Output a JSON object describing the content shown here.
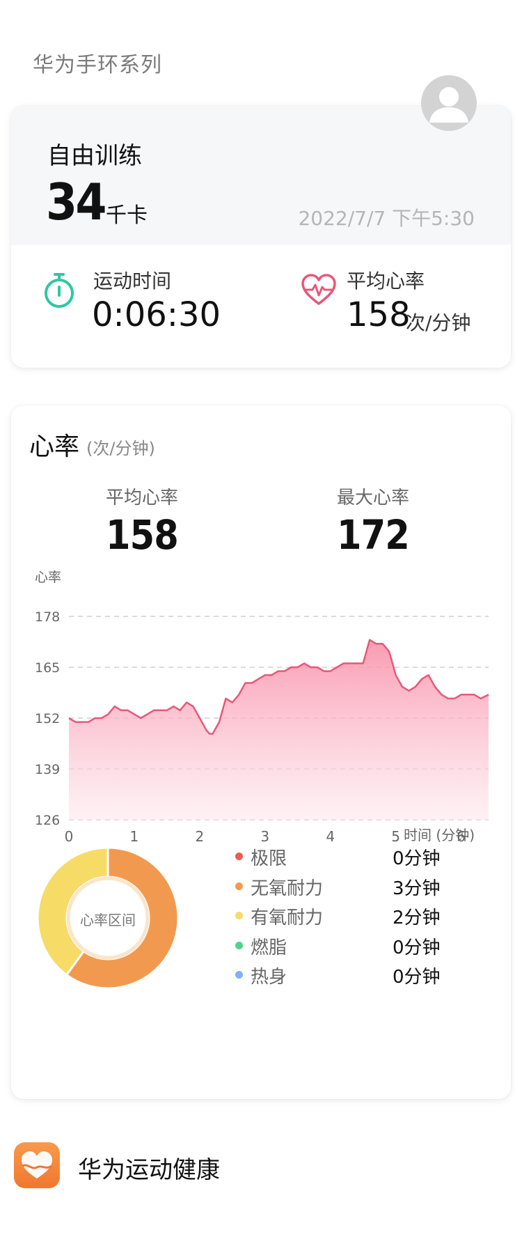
{
  "header": {
    "device_series": "华为手环系列",
    "avatar_icon": "user-avatar-icon"
  },
  "workout": {
    "name": "自由训练",
    "calories": "34",
    "calories_unit": "千卡",
    "datetime": "2022/7/7 下午5:30",
    "duration_label": "运动时间",
    "duration_value": "0:06:30",
    "duration_icon": "stopwatch-icon",
    "avg_hr_label": "平均心率",
    "avg_hr_value": "158",
    "avg_hr_unit": "次/分钟",
    "avg_hr_icon": "heart-pulse-icon"
  },
  "heart_rate": {
    "title": "心率",
    "title_unit": "(次/分钟)",
    "avg_label": "平均心率",
    "avg_value": "158",
    "max_label": "最大心率",
    "max_value": "172",
    "zone_center_label": "心率区间",
    "zones": [
      {
        "label": "极限",
        "value": "0分钟",
        "color": "#ee5b4f"
      },
      {
        "label": "无氧耐力",
        "value": "3分钟",
        "color": "#f19a4f"
      },
      {
        "label": "有氧耐力",
        "value": "2分钟",
        "color": "#f6dc66"
      },
      {
        "label": "燃脂",
        "value": "0分钟",
        "color": "#4fd389"
      },
      {
        "label": "热身",
        "value": "0分钟",
        "color": "#7fb2ef"
      }
    ]
  },
  "chart_data": [
    {
      "type": "area",
      "ylabel": "心率",
      "xlabel": "时间 (分钟)",
      "yticks": [
        126,
        139,
        152,
        165,
        178
      ],
      "xticks": [
        0,
        1,
        2,
        3,
        4,
        5,
        6
      ],
      "ylim": [
        126,
        178
      ],
      "xlim": [
        0,
        6.42
      ],
      "grid": "horizontal dashed",
      "color": "#e8577a",
      "x": [
        0,
        0.1,
        0.2,
        0.3,
        0.4,
        0.5,
        0.6,
        0.7,
        0.8,
        0.9,
        1.0,
        1.1,
        1.2,
        1.3,
        1.4,
        1.5,
        1.6,
        1.7,
        1.8,
        1.9,
        2.0,
        2.1,
        2.15,
        2.2,
        2.3,
        2.4,
        2.5,
        2.6,
        2.7,
        2.8,
        2.9,
        3.0,
        3.1,
        3.2,
        3.3,
        3.4,
        3.5,
        3.6,
        3.7,
        3.8,
        3.9,
        4.0,
        4.1,
        4.2,
        4.3,
        4.4,
        4.5,
        4.6,
        4.7,
        4.8,
        4.9,
        5.0,
        5.1,
        5.2,
        5.3,
        5.4,
        5.5,
        5.6,
        5.7,
        5.8,
        5.9,
        6.0,
        6.1,
        6.2,
        6.3,
        6.42
      ],
      "values": [
        152,
        151,
        151,
        151,
        152,
        152,
        153,
        155,
        154,
        154,
        153,
        152,
        153,
        154,
        154,
        154,
        155,
        154,
        156,
        155,
        152,
        149,
        148,
        148,
        151,
        157,
        156,
        158,
        161,
        161,
        162,
        163,
        163,
        164,
        164,
        165,
        165,
        166,
        165,
        165,
        164,
        164,
        165,
        166,
        166,
        166,
        166,
        172,
        171,
        171,
        169,
        163,
        160,
        159,
        160,
        162,
        163,
        160,
        158,
        157,
        157,
        158,
        158,
        158,
        157,
        158
      ]
    },
    {
      "type": "pie",
      "subtype": "donut",
      "categories": [
        "极限",
        "无氧耐力",
        "有氧耐力",
        "燃脂",
        "热身"
      ],
      "values": [
        0,
        3,
        2,
        0,
        0
      ],
      "colors": [
        "#ee5b4f",
        "#f19a4f",
        "#f6dc66",
        "#4fd389",
        "#7fb2ef"
      ]
    }
  ],
  "footer": {
    "app_name": "华为运动健康",
    "app_icon": "huawei-health-logo-icon"
  }
}
